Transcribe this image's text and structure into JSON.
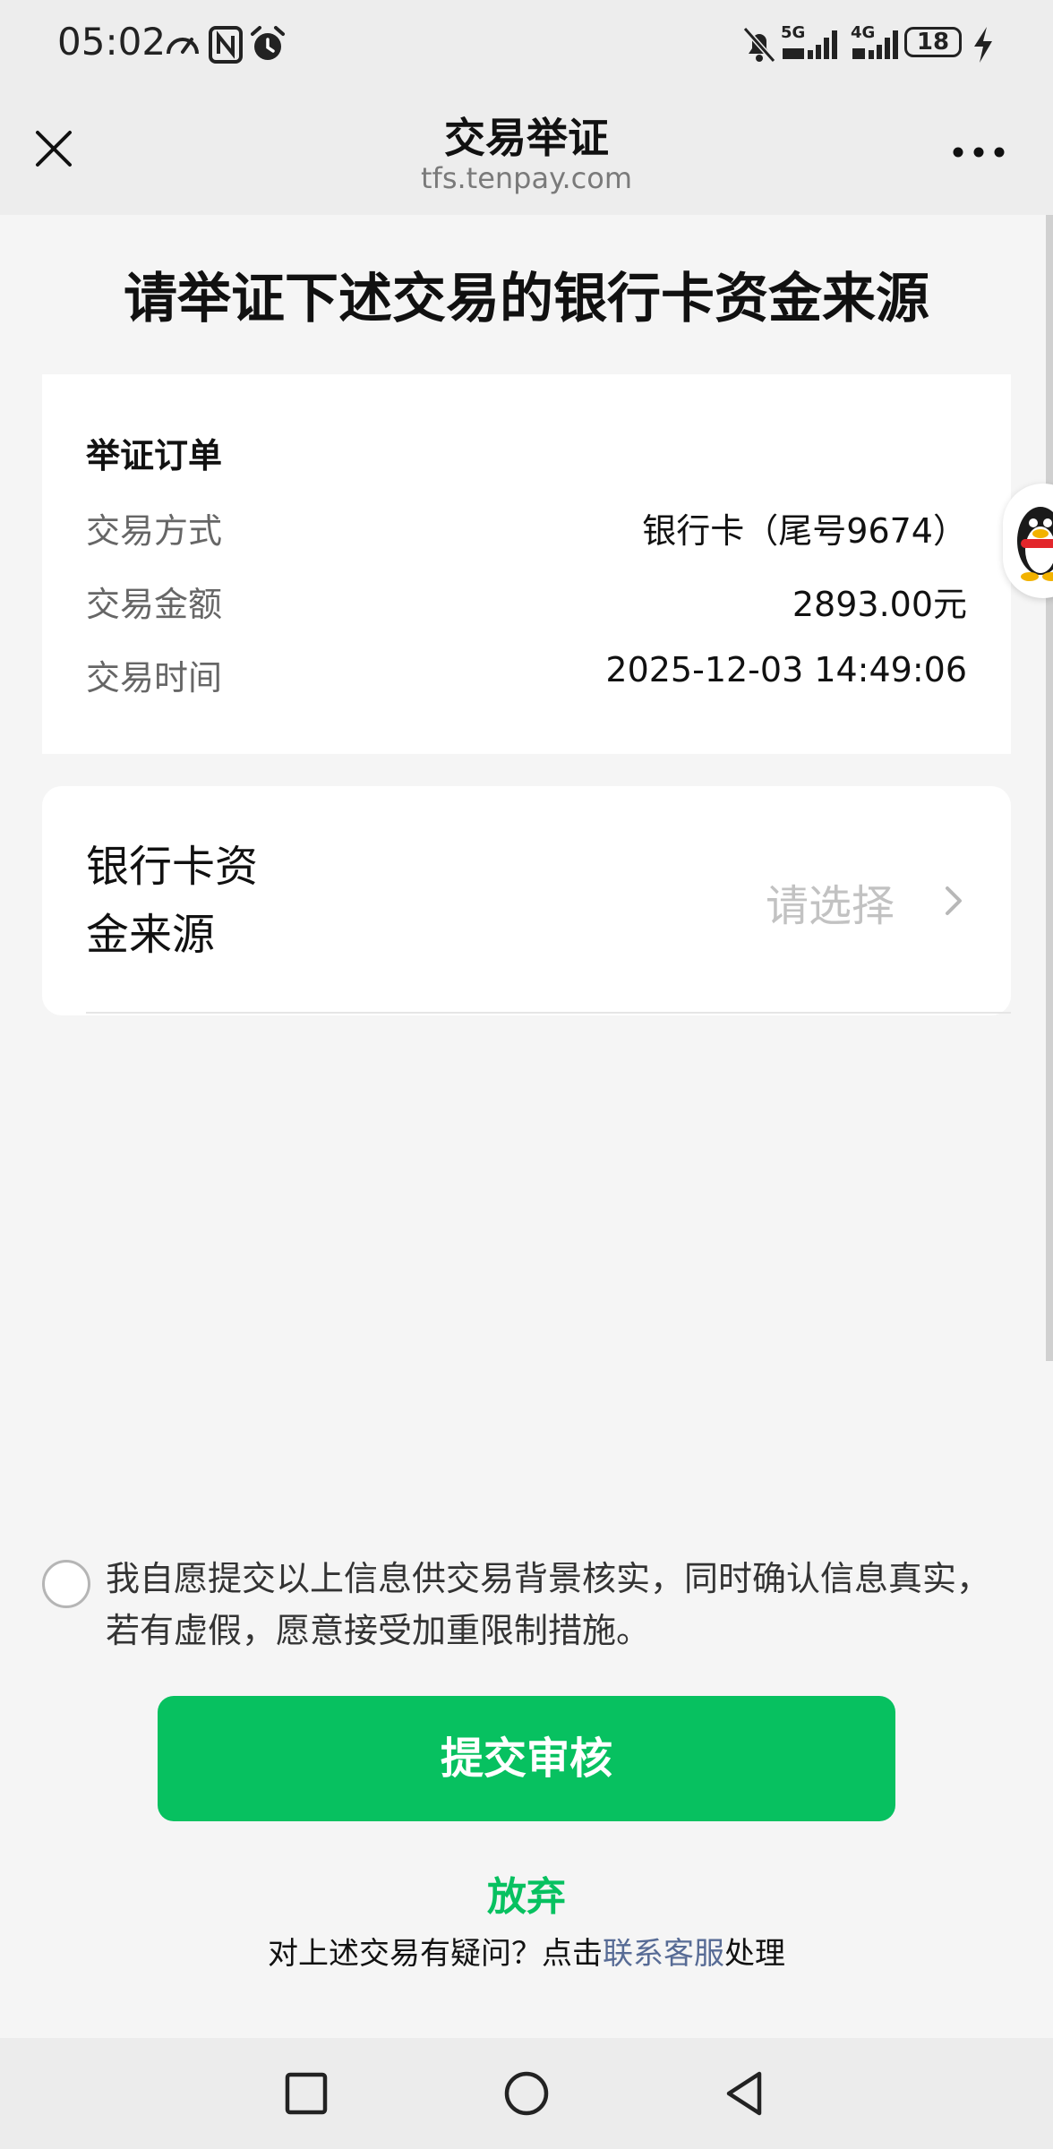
{
  "status_bar": {
    "time": "05:02",
    "battery": "18",
    "network_1": "5G",
    "network_2": "4G",
    "icons": [
      "speedometer-icon",
      "nfc-icon",
      "alarm-icon",
      "mute-icon",
      "signal-icon",
      "charging-icon"
    ]
  },
  "nav": {
    "title": "交易举证",
    "url": "tfs.tenpay.com",
    "close_icon": "close-icon",
    "more_icon": "more-icon"
  },
  "headline": "请举证下述交易的银行卡资金来源",
  "order_card": {
    "title": "举证订单",
    "rows": [
      {
        "label": "交易方式",
        "value": "银行卡（尾号9674）"
      },
      {
        "label": "交易金额",
        "value": "2893.00元"
      },
      {
        "label": "交易时间",
        "value": "2025-12-03 14:49:06"
      }
    ]
  },
  "source_card": {
    "label": "银行卡资金来源",
    "label_line1": "银行卡资",
    "label_line2": "金来源",
    "placeholder": "请选择"
  },
  "agreement": {
    "text": "我自愿提交以上信息供交易背景核实，同时确认信息真实，若有虚假，愿意接受加重限制措施。",
    "checked": false
  },
  "submit_label": "提交审核",
  "giveup_label": "放弃",
  "help": {
    "prefix": "对上述交易有疑问？点击",
    "link": "联系客服",
    "suffix": "处理"
  },
  "colors": {
    "accent": "#07c160",
    "link": "#576b95",
    "background": "#f5f5f5"
  }
}
